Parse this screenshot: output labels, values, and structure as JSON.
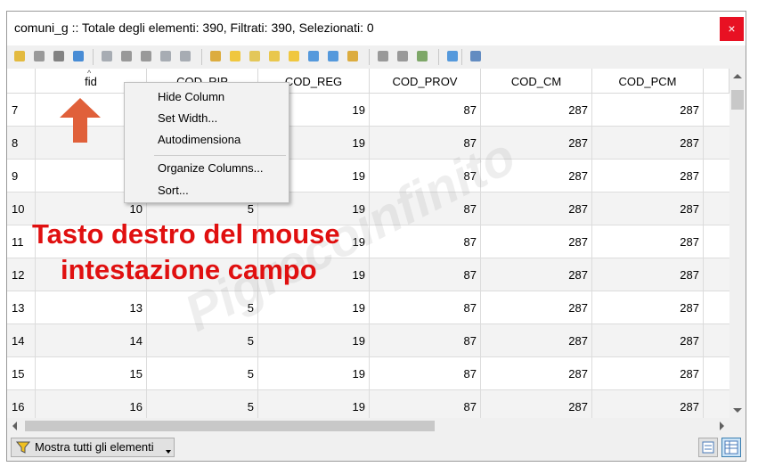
{
  "window": {
    "title": "comuni_g :: Totale degli elementi: 390, Filtrati: 390, Selezionati: 0",
    "close_glyph": "×"
  },
  "toolbar": {
    "icons": [
      "pencil-icon",
      "multi-edit-icon",
      "save-icon",
      "reload-icon",
      "add-feature-icon",
      "delete-icon",
      "cut-icon",
      "copy-icon",
      "paste-icon",
      "expression-select-icon",
      "select-all-icon",
      "invert-selection-icon",
      "deselect-icon",
      "filter-icon",
      "move-top-icon",
      "pan-icon",
      "zoom-icon",
      "new-field-icon",
      "delete-field-icon",
      "field-calculator-icon",
      "conditional-format-icon",
      "dock-icon"
    ]
  },
  "table": {
    "columns": [
      "fid",
      "COD_RIP",
      "COD_REG",
      "COD_PROV",
      "COD_CM",
      "COD_PCM"
    ],
    "rows": [
      {
        "n": "7",
        "cells": [
          "",
          "",
          "19",
          "87",
          "287",
          "287"
        ]
      },
      {
        "n": "8",
        "cells": [
          "",
          "",
          "19",
          "87",
          "287",
          "287"
        ]
      },
      {
        "n": "9",
        "cells": [
          "",
          "",
          "19",
          "87",
          "287",
          "287"
        ]
      },
      {
        "n": "10",
        "cells": [
          "10",
          "5",
          "19",
          "87",
          "287",
          "287"
        ]
      },
      {
        "n": "11",
        "cells": [
          "",
          "",
          "19",
          "87",
          "287",
          "287"
        ]
      },
      {
        "n": "12",
        "cells": [
          "",
          "",
          "19",
          "87",
          "287",
          "287"
        ]
      },
      {
        "n": "13",
        "cells": [
          "13",
          "5",
          "19",
          "87",
          "287",
          "287"
        ]
      },
      {
        "n": "14",
        "cells": [
          "14",
          "5",
          "19",
          "87",
          "287",
          "287"
        ]
      },
      {
        "n": "15",
        "cells": [
          "15",
          "5",
          "19",
          "87",
          "287",
          "287"
        ]
      },
      {
        "n": "16",
        "cells": [
          "16",
          "5",
          "19",
          "87",
          "287",
          "287"
        ]
      }
    ]
  },
  "context_menu": {
    "items": [
      "Hide Column",
      "Set Width...",
      "Autodimensiona",
      "Organize Columns...",
      "Sort..."
    ]
  },
  "statusbar": {
    "filter_label": "Mostra tutti gli elementi"
  },
  "annotation": {
    "line1": "Tasto destro del mouse",
    "line2": "intestazione campo",
    "watermark": "Pigrecoinfinito"
  },
  "colors": {
    "annotation": "#e01010",
    "arrow": "#e0603a",
    "close": "#e81123"
  }
}
